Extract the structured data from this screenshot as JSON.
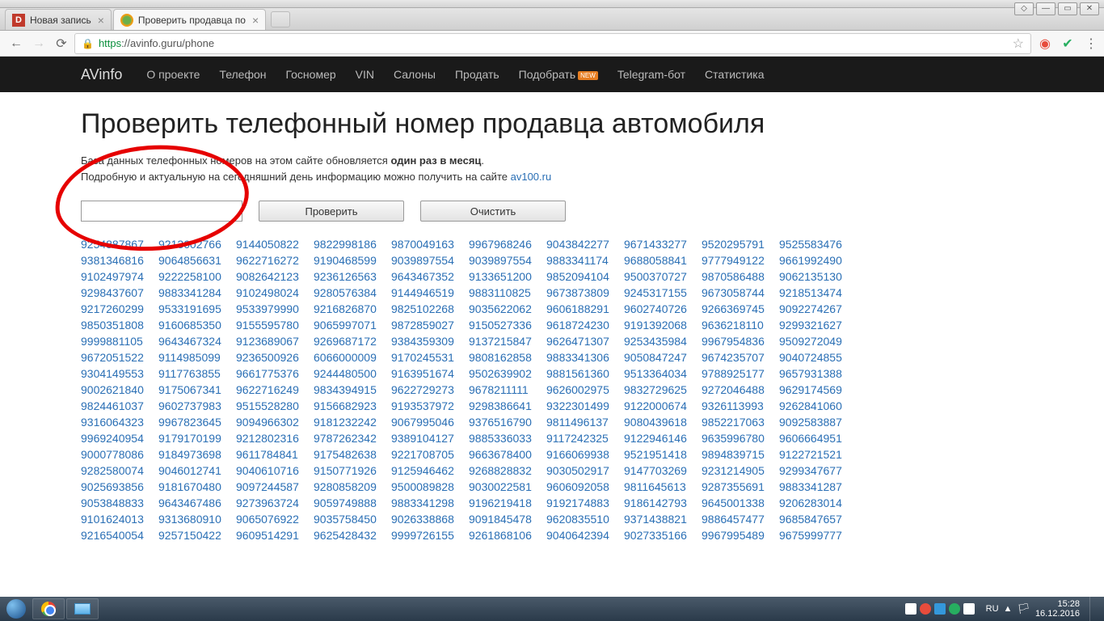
{
  "window": {
    "controls": {
      "user": "◇",
      "min": "—",
      "max": "▭",
      "close": "✕"
    }
  },
  "tabs": {
    "t1": {
      "title": "Новая запись"
    },
    "t2": {
      "title": "Проверить продавца по"
    }
  },
  "url": {
    "proto": "https",
    "host_path": "://avinfo.guru/phone"
  },
  "nav": {
    "brand": "AVinfo",
    "about": "О проекте",
    "phone": "Телефон",
    "gos": "Госномер",
    "vin": "VIN",
    "salons": "Салоны",
    "sell": "Продать",
    "pick": "Подобрать",
    "new": "NEW",
    "tg": "Telegram-бот",
    "stats": "Статистика"
  },
  "page": {
    "h1": "Проверить телефонный номер продавца автомобиля",
    "desc1a": "База данных телефонных номеров на этом сайте обновляется ",
    "desc1b": "один раз в месяц",
    "desc1c": ".",
    "desc2a": "Подробную и актуальную на сегодняшний день информацию можно получить на сайте ",
    "desc2link": "av100.ru",
    "btn_check": "Проверить",
    "btn_clear": "Очистить"
  },
  "phones": [
    "9254887867",
    "9213602766",
    "9144050822",
    "9822998186",
    "9870049163",
    "9967968246",
    "9043842277",
    "9671433277",
    "9520295791",
    "9525583476",
    "9381346816",
    "9064856631",
    "9622716272",
    "9190468599",
    "9039897554",
    "9039897554",
    "9883341174",
    "9688058841",
    "9777949122",
    "9661992490",
    "9102497974",
    "9222258100",
    "9082642123",
    "9236126563",
    "9643467352",
    "9133651200",
    "9852094104",
    "9500370727",
    "9870586488",
    "9062135130",
    "9298437607",
    "9883341284",
    "9102498024",
    "9280576384",
    "9144946519",
    "9883110825",
    "9673873809",
    "9245317155",
    "9673058744",
    "9218513474",
    "9217260299",
    "9533191695",
    "9533979990",
    "9216826870",
    "9825102268",
    "9035622062",
    "9606188291",
    "9602740726",
    "9266369745",
    "9092274267",
    "9850351808",
    "9160685350",
    "9155595780",
    "9065997071",
    "9872859027",
    "9150527336",
    "9618724230",
    "9191392068",
    "9636218110",
    "9299321627",
    "9999881105",
    "9643467324",
    "9123689067",
    "9269687172",
    "9384359309",
    "9137215847",
    "9626471307",
    "9253435984",
    "9967954836",
    "9509272049",
    "9672051522",
    "9114985099",
    "9236500926",
    "6066000009",
    "9170245531",
    "9808162858",
    "9883341306",
    "9050847247",
    "9674235707",
    "9040724855",
    "9304149553",
    "9117763855",
    "9661775376",
    "9244480500",
    "9163951674",
    "9502639902",
    "9881561360",
    "9513364034",
    "9788925177",
    "9657931388",
    "9002621840",
    "9175067341",
    "9622716249",
    "9834394915",
    "9622729273",
    "9678211111",
    "9626002975",
    "9832729625",
    "9272046488",
    "9629174569",
    "9824461037",
    "9602737983",
    "9515528280",
    "9156682923",
    "9193537972",
    "9298386641",
    "9322301499",
    "9122000674",
    "9326113993",
    "9262841060",
    "9316064323",
    "9967823645",
    "9094966302",
    "9181232242",
    "9067995046",
    "9376516790",
    "9811496137",
    "9080439618",
    "9852217063",
    "9092583887",
    "9969240954",
    "9179170199",
    "9212802316",
    "9787262342",
    "9389104127",
    "9885336033",
    "9117242325",
    "9122946146",
    "9635996780",
    "9606664951",
    "9000778086",
    "9184973698",
    "9611784841",
    "9175482638",
    "9221708705",
    "9663678400",
    "9166069938",
    "9521951418",
    "9894839715",
    "9122721521",
    "9282580074",
    "9046012741",
    "9040610716",
    "9150771926",
    "9125946462",
    "9268828832",
    "9030502917",
    "9147703269",
    "9231214905",
    "9299347677",
    "9025693856",
    "9181670480",
    "9097244587",
    "9280858209",
    "9500089828",
    "9030022581",
    "9606092058",
    "9811645613",
    "9287355691",
    "9883341287",
    "9053848833",
    "9643467486",
    "9273963724",
    "9059749888",
    "9883341298",
    "9196219418",
    "9192174883",
    "9186142793",
    "9645001338",
    "9206283014",
    "9101624013",
    "9313680910",
    "9065076922",
    "9035758450",
    "9026338868",
    "9091845478",
    "9620835510",
    "9371438821",
    "9886457477",
    "9685847657",
    "9216540054",
    "9257150422",
    "9609514291",
    "9625428432",
    "9999726155",
    "9261868106",
    "9040642394",
    "9027335166",
    "9967995489",
    "9675999777"
  ],
  "taskbar": {
    "lang": "RU",
    "time": "15:28",
    "date": "16.12.2016"
  }
}
